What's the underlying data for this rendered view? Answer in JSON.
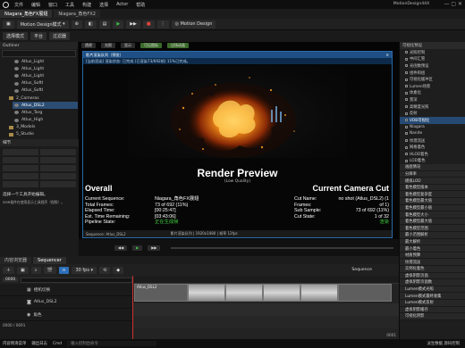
{
  "menubar": {
    "items": [
      "文件",
      "编辑",
      "窗口",
      "工具",
      "构建",
      "选择",
      "Actor",
      "帮助"
    ],
    "project_name": "MotionDesign444"
  },
  "tabs": [
    {
      "label": "Niagara_角色FX展翅"
    },
    {
      "label": "Niagara_角色FX2"
    }
  ],
  "toolbar": {
    "mode_label": "Motion Design模式",
    "motion_design_label": "Motion Design",
    "buttons": [
      "选择模式",
      "平台",
      "过滤器"
    ]
  },
  "left_panel": {
    "title": "Outliner",
    "items": [
      {
        "label": "Atlus_Light",
        "selected": false
      },
      {
        "label": "Atlus_Light",
        "selected": false
      },
      {
        "label": "Atlus_Light",
        "selected": false
      },
      {
        "label": "Atlus_SoftI",
        "selected": false
      },
      {
        "label": "Atlus_SoftI",
        "selected": false
      },
      {
        "label": "2_Cameras",
        "selected": false
      },
      {
        "label": "Atlus_DSL2",
        "selected": true
      },
      {
        "label": "Atlus_Targ",
        "selected": false
      },
      {
        "label": "Atlus_High",
        "selected": false
      },
      {
        "label": "3_Models",
        "selected": false
      },
      {
        "label": "5_Studio",
        "selected": false
      }
    ],
    "details_header": "细节",
    "details_note": "选择一个工具开始编辑。",
    "details_note2": "SMR插件在使用显示工具程序（视频）。"
  },
  "modal": {
    "window_title": "影片渲染队列（预览）",
    "info_bar": "[当前渲染] 渲染状态: 已完成 (已渲染73/692帧) 11%已完成。",
    "render_title": "Render Preview",
    "render_subtitle": "(Low Quality)",
    "overall_heading": "Overall",
    "camera_heading": "Current Camera Cut",
    "overall": [
      {
        "key": "Current Sequence:",
        "value": "Niagara_角色FX展翅"
      },
      {
        "key": "Total Frames:",
        "value": "73 of 692 (11%)"
      },
      {
        "key": "Elapsed Time:",
        "value": "[00:25:47]"
      },
      {
        "key": "Est. Time Remaining:",
        "value": "[03:43:06]"
      },
      {
        "key": "Pipeline State:",
        "value": "正在生成帧"
      }
    ],
    "camera": [
      {
        "key": "Cut Name:",
        "value": "no shot (Atlus_DSL2) (1 of 1)"
      },
      {
        "key": "Frames:",
        "value": "73 of 692 (11%)"
      },
      {
        "key": "Sub Sample:",
        "value": "1 of 32"
      },
      {
        "key": "Cut State:",
        "value": "渲染"
      }
    ],
    "footer": "Sequence: Atlus_DSL2",
    "footer_right": "影片渲染队列 | 1920x1080 | 帧率 12fps"
  },
  "viewport": {
    "top_labels": [
      "透视",
      "光照",
      "显示",
      "可见图标",
      "过场动画"
    ]
  },
  "sequencer": {
    "tabs": [
      "内容浏览器",
      "Sequencer"
    ],
    "fps": "30 fps",
    "sequence_name": "Sequence",
    "timecode_left": "0000",
    "timecode_right": "0001",
    "frame_counter": "0000 / 0691",
    "tracks": [
      {
        "label": "相机切换",
        "value": ""
      },
      {
        "label": "Atlus_DSL2",
        "value": ""
      },
      {
        "label": "角色",
        "value": ""
      }
    ],
    "clip_label": "Atlus_DSL2"
  },
  "right_panel": {
    "header": "可视化预设",
    "items": [
      "光照控制",
      "中间汇管",
      "光函数预设",
      "组件和组",
      "可视化缓冲区",
      "Lumen场景",
      "体素化",
      "景深",
      "高精度光照",
      "反射",
      "VDB可视化",
      "Niagara",
      "Nanite",
      "纹理流送",
      "网格着色",
      "HLOD着色",
      "LOD着色",
      "着色物理",
      "虚拟纹理",
      "着色器复杂度"
    ],
    "highlighted_index": 10,
    "boxes": [
      "画面情况",
      "分辨率",
      "模拟LOD",
      "着色模型版本",
      "着色模型复杂度",
      "着色模型最大值",
      "着色模型最小值",
      "着色模型大小",
      "着色模型最大值",
      "着色模型范围",
      "最小范围解析",
      "最大解析",
      "最小着色",
      "材质预算",
      "纹理流送",
      "实例化着色",
      "虚拟阴影页面",
      "虚拟阴影页面数",
      "Lumen模式光照",
      "Lumen模式最终收集",
      "Lumen模式反射",
      "虚拟阴影缓存",
      "可视化阴影"
    ]
  },
  "statusbar": {
    "items": [
      "内容侧滑菜单",
      "输出日志",
      "Cmd",
      "输入控制台命令"
    ],
    "right": "派生数据  源码控制"
  },
  "colors": {
    "accent_blue": "#1f4f84",
    "play_green": "#3ec34a",
    "stop_red": "#e0443c",
    "fire_orange": "#f08a18"
  }
}
